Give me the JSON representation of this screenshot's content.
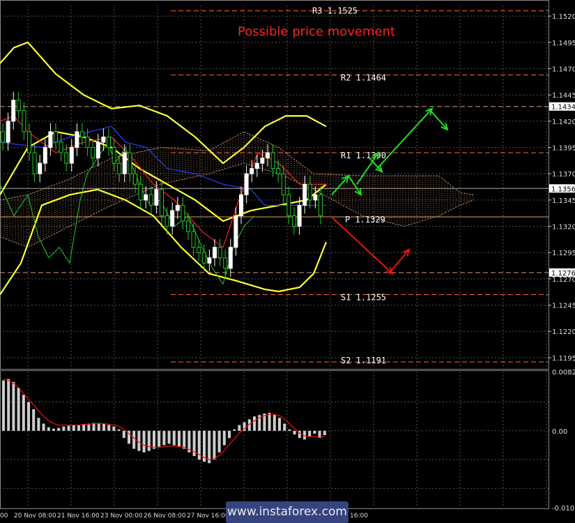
{
  "chart_data": [
    {
      "type": "line",
      "title": "Possible price movement",
      "ylim": [
        1.1185,
        1.153
      ],
      "y_ticks": [
        "1.1520",
        "1.1495",
        "1.1470",
        "1.1445",
        "1.1420",
        "1.1395",
        "1.1370",
        "1.1345",
        "1.1320",
        "1.1295",
        "1.1270",
        "1.1245",
        "1.1220",
        "1.1195"
      ],
      "x_ticks": [
        "20 Nov 08:00",
        "21 Nov 16:00",
        "23 Nov 00:00",
        "26 Nov 08:00",
        "27 Nov 16:00"
      ],
      "x_tick_partial": {
        "left": "00",
        "right": "16:00"
      },
      "pivot_levels": [
        {
          "name": "R3",
          "value": 1.1525,
          "label": "R3 1.1525"
        },
        {
          "name": "R2",
          "value": 1.1464,
          "label": "R2 1.1464"
        },
        {
          "name": "R1",
          "value": 1.139,
          "label": "R1 1.1390"
        },
        {
          "name": "P",
          "value": 1.1329,
          "label": "P 1.1329"
        },
        {
          "name": "S1",
          "value": 1.1255,
          "label": "S1 1.1255"
        },
        {
          "name": "S2",
          "value": 1.1191,
          "label": "S2 1.1191"
        }
      ],
      "price_tags": [
        {
          "value": 1.1434,
          "label": "1.1434",
          "color": "#ffffff",
          "text_color": "#000000"
        },
        {
          "value": 1.1356,
          "label": "1.1356",
          "color": "#ffffff",
          "text_color": "#000000"
        },
        {
          "value": 1.1276,
          "label": "1.1276",
          "color": "#ffffff",
          "text_color": "#000000"
        }
      ],
      "colors": {
        "bollinger": "#ffff33",
        "ichimoku_tenkan": "#ff2222",
        "ichimoku_kijun": "#2244ff",
        "chikou": "#22cc22",
        "cloud": "#d8a070",
        "bull_candle": "#ffffff",
        "bear_candle": "#22cc22",
        "arrow_up": "#22dd22",
        "arrow_down": "#ee1111",
        "levels": "#ff6633",
        "title": "#ff2222"
      }
    },
    {
      "type": "bar",
      "title": "",
      "ylim": [
        -0.01068,
        0.00822
      ],
      "y_ticks": [
        "0.00822",
        "0.00",
        "-0.01068"
      ],
      "values": [
        0.007,
        0.0072,
        0.0068,
        0.006,
        0.005,
        0.004,
        0.003,
        0.0018,
        0.001,
        0.0005,
        0.0003,
        0.0004,
        0.0006,
        0.0007,
        0.0008,
        0.0008,
        0.0009,
        0.001,
        0.0011,
        0.0011,
        0.001,
        0.0008,
        0.0006,
        0.0002,
        -0.001,
        -0.0018,
        -0.0025,
        -0.0028,
        -0.003,
        -0.0028,
        -0.0025,
        -0.0022,
        -0.002,
        -0.0018,
        -0.002,
        -0.0022,
        -0.0025,
        -0.003,
        -0.0035,
        -0.004,
        -0.0043,
        -0.0045,
        -0.004,
        -0.003,
        -0.002,
        -0.001,
        0.0002,
        0.0008,
        0.0012,
        0.0016,
        0.002,
        0.0022,
        0.0024,
        0.0025,
        0.0022,
        0.0018,
        0.001,
        0.0002,
        -0.0005,
        -0.001,
        -0.0012,
        -0.0008,
        -0.0004,
        -0.001,
        -0.0006
      ],
      "signal": [
        0.0072,
        0.007,
        0.0066,
        0.006,
        0.0052,
        0.0044,
        0.0036,
        0.0028,
        0.002,
        0.0014,
        0.001,
        0.0008,
        0.0008,
        0.0008,
        0.0008,
        0.0008,
        0.0009,
        0.0009,
        0.001,
        0.001,
        0.001,
        0.0009,
        0.0008,
        0.0006,
        0.0002,
        -0.0004,
        -0.001,
        -0.0016,
        -0.002,
        -0.0022,
        -0.0023,
        -0.0023,
        -0.0022,
        -0.0021,
        -0.0021,
        -0.0022,
        -0.0023,
        -0.0026,
        -0.0029,
        -0.0033,
        -0.0037,
        -0.004,
        -0.0039,
        -0.0034,
        -0.0027,
        -0.0019,
        -0.0011,
        -0.0003,
        0.0003,
        0.0009,
        0.0014,
        0.0018,
        0.0021,
        0.0023,
        0.0023,
        0.0021,
        0.0016,
        0.001,
        0.0003,
        -0.0003,
        -0.0007,
        -0.0008,
        -0.0008,
        -0.0009,
        -0.0008
      ],
      "colors": {
        "bars": "#cccccc",
        "signal": "#ee1111"
      }
    }
  ],
  "watermark": {
    "text": "www.instaforex.com"
  }
}
